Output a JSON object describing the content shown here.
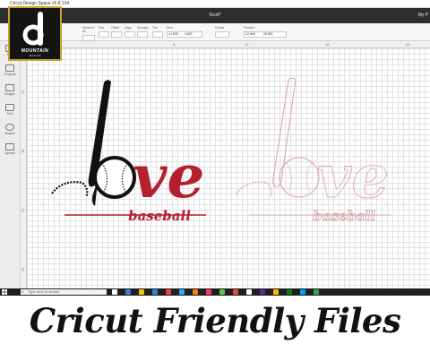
{
  "window": {
    "title": "Cricut Design Space  v5.8.134"
  },
  "header": {
    "project_name": "Scott*",
    "menu_partial": "My P"
  },
  "toolbar": {
    "items": [
      {
        "label": "Deselect All"
      },
      {
        "label": "Edit"
      },
      {
        "label": "Offset"
      },
      {
        "label": "Align"
      },
      {
        "label": "Arrange"
      },
      {
        "label": "Flip"
      },
      {
        "label": "Size"
      },
      {
        "label": "Rotate"
      },
      {
        "label": "Position"
      }
    ],
    "size_w": "14.833",
    "size_h": "4.623",
    "pos_x": "12.895",
    "pos_y": "28.383"
  },
  "sidebar": {
    "items": [
      {
        "label": "New"
      },
      {
        "label": "Projects"
      },
      {
        "label": "Images"
      },
      {
        "label": "Text"
      },
      {
        "label": "Shapes"
      },
      {
        "label": "Upload"
      }
    ]
  },
  "rulers": {
    "top": [
      "6",
      "12",
      "18",
      "24"
    ],
    "left": [
      "12",
      "18",
      "24",
      "30"
    ]
  },
  "taskbar": {
    "search_placeholder": "Type here to search"
  },
  "logo": {
    "name": "MOUNTAIN",
    "sub": "DESIGNS"
  },
  "canvas_text": {
    "main_word": "ve",
    "sub_word": "baseball"
  },
  "caption": "Cricut Friendly Files",
  "colors": {
    "primary": "#b5202e",
    "outline": "#e3a6ad",
    "topbar": "#2e2e2e",
    "logo_border": "#c9a227"
  }
}
